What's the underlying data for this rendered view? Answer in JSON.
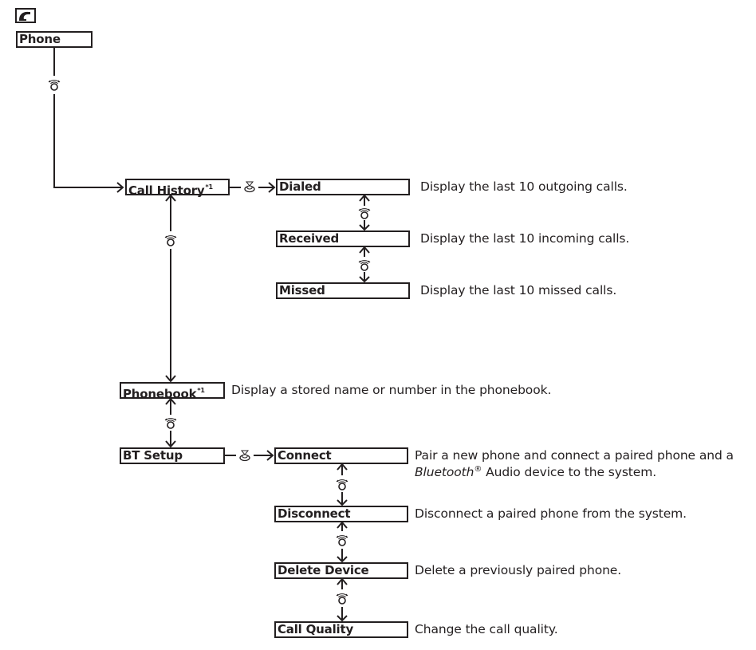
{
  "icons": {
    "phone_header": "phone-handset-icon",
    "scroll_knob": "interface-dial-rotate-icon",
    "press_knob": "interface-dial-press-icon"
  },
  "colors": {
    "ink": "#231f20",
    "background": "#ffffff"
  },
  "root": {
    "label": "Phone"
  },
  "call_history": {
    "label": "Call History",
    "footnote": "*1",
    "items": [
      {
        "label": "Dialed",
        "description": "Display the last 10 outgoing calls."
      },
      {
        "label": "Received",
        "description": "Display the last 10 incoming calls."
      },
      {
        "label": "Missed",
        "description": "Display the last 10 missed calls."
      }
    ]
  },
  "phonebook": {
    "label": "Phonebook",
    "footnote": "*1",
    "description": "Display a stored name or number in the phonebook."
  },
  "bt_setup": {
    "label": "BT Setup",
    "items": [
      {
        "label": "Connect",
        "description_line1": "Pair a new phone and connect a paired phone and a",
        "description_line2_italic": "Bluetooth",
        "description_line2_reg": "®",
        "description_line2_rest": " Audio device to the system."
      },
      {
        "label": "Disconnect",
        "description": "Disconnect a paired phone from the system."
      },
      {
        "label": "Delete Device",
        "description": "Delete a previously paired phone."
      },
      {
        "label": "Call Quality",
        "description": "Change the call quality."
      }
    ]
  }
}
